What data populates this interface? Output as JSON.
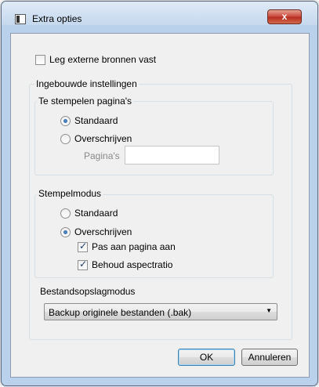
{
  "window": {
    "title": "Extra opties",
    "close_glyph": "x"
  },
  "options": {
    "fix_external_sources": {
      "label": "Leg externe bronnen vast",
      "checked": false
    }
  },
  "builtin": {
    "title": "Ingebouwde instellingen",
    "pages_to_stamp": {
      "title": "Te stempelen pagina's",
      "standard": {
        "label": "Standaard",
        "selected": true
      },
      "overwrite": {
        "label": "Overschrijven",
        "selected": false
      },
      "pages_label": "Pagina's",
      "pages_value": ""
    },
    "stamp_mode": {
      "title": "Stempelmodus",
      "standard": {
        "label": "Standaard",
        "selected": false
      },
      "overwrite": {
        "label": "Overschrijven",
        "selected": true
      },
      "fit_page": {
        "label": "Pas aan pagina aan",
        "checked": true
      },
      "keep_aspect": {
        "label": "Behoud aspectratio",
        "checked": true
      }
    },
    "storage_mode": {
      "title": "Bestandsopslagmodus",
      "selected": "Backup originele bestanden (.bak)"
    }
  },
  "buttons": {
    "ok": "OK",
    "cancel": "Annuleren"
  }
}
